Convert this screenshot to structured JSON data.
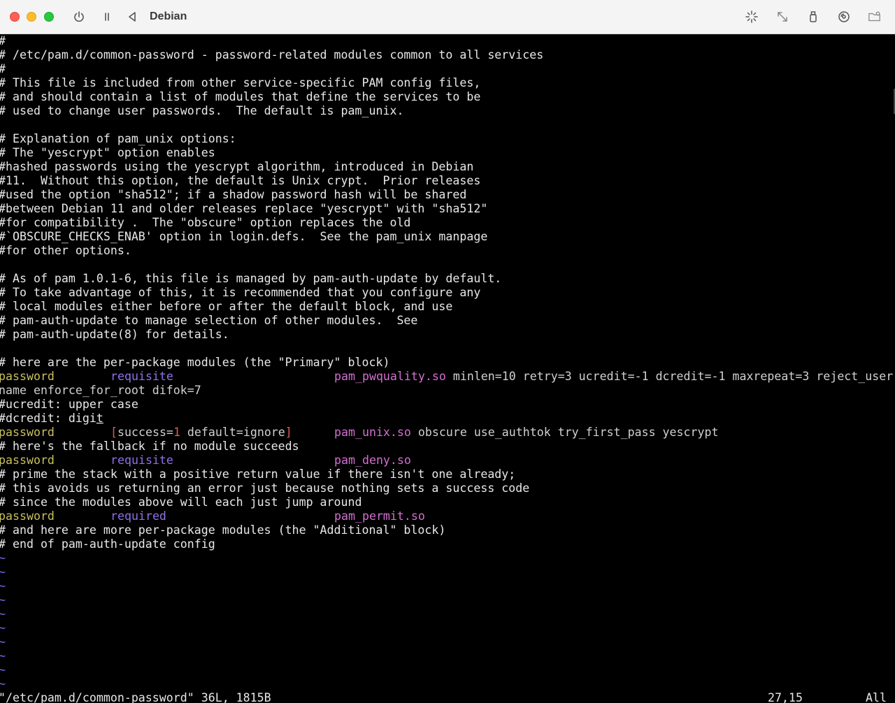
{
  "window": {
    "title": "Debian",
    "colors": {
      "close": "#ff5f57",
      "minimize": "#febc2e",
      "maximize": "#28c840"
    },
    "toolbar_icons": [
      "power-icon",
      "pause-icon",
      "back-icon",
      "brightness-icon",
      "resize-icon",
      "usb-icon",
      "disc-icon",
      "shared-folder-icon"
    ]
  },
  "editor": {
    "file_path": "/etc/pam.d/common-password",
    "lines": [
      "#",
      "# /etc/pam.d/common-password - password-related modules common to all services",
      "#",
      "# This file is included from other service-specific PAM config files,",
      "# and should contain a list of modules that define the services to be",
      "# used to change user passwords.  The default is pam_unix.",
      "",
      "# Explanation of pam_unix options:",
      "# The \"yescrypt\" option enables",
      "#hashed passwords using the yescrypt algorithm, introduced in Debian",
      "#11.  Without this option, the default is Unix crypt.  Prior releases",
      "#used the option \"sha512\"; if a shadow password hash will be shared",
      "#between Debian 11 and older releases replace \"yescrypt\" with \"sha512\"",
      "#for compatibility .  The \"obscure\" option replaces the old",
      "#`OBSCURE_CHECKS_ENAB' option in login.defs.  See the pam_unix manpage",
      "#for other options.",
      "",
      "# As of pam 1.0.1-6, this file is managed by pam-auth-update by default.",
      "# To take advantage of this, it is recommended that you configure any",
      "# local modules either before or after the default block, and use",
      "# pam-auth-update to manage selection of other modules.  See",
      "# pam-auth-update(8) for details.",
      "",
      "# here are the per-package modules (the \"Primary\" block)"
    ],
    "rule1": {
      "type": "password",
      "control": "requisite",
      "module": "pam_pwquality.so",
      "args": " minlen=10 retry=3 ucredit=-1 dcredit=-1 maxrepeat=3 reject_user",
      "wrap": "name enforce_for_root difok=7"
    },
    "comment_ucredit": "#ucredit: upper case",
    "comment_dcredit_prefix": "#dcredit: digi",
    "comment_dcredit_cursor": "t",
    "rule2": {
      "type": "password",
      "bracket_open": "[",
      "success_key": "success=",
      "success_val": "1",
      "default_part": " default=ignore",
      "bracket_close": "]",
      "module": "pam_unix.so",
      "args": " obscure use_authtok try_first_pass yescrypt"
    },
    "comment_fallback": "# here's the fallback if no module succeeds",
    "rule3": {
      "type": "password",
      "control": "requisite",
      "module": "pam_deny.so"
    },
    "comments_prime": [
      "# prime the stack with a positive return value if there isn't one already;",
      "# this avoids us returning an error just because nothing sets a success code",
      "# since the modules above will each just jump around"
    ],
    "rule4": {
      "type": "password",
      "control": "required",
      "module": "pam_permit.so"
    },
    "comments_end": [
      "# and here are more per-package modules (the \"Additional\" block)",
      "# end of pam-auth-update config"
    ],
    "tildes": [
      "~",
      "~",
      "~",
      "~",
      "~",
      "~",
      "~",
      "~",
      "~",
      "~"
    ],
    "status": {
      "file_info": "\"/etc/pam.d/common-password\" 36L, 1815B",
      "position": "27,15",
      "scroll": "All"
    }
  }
}
